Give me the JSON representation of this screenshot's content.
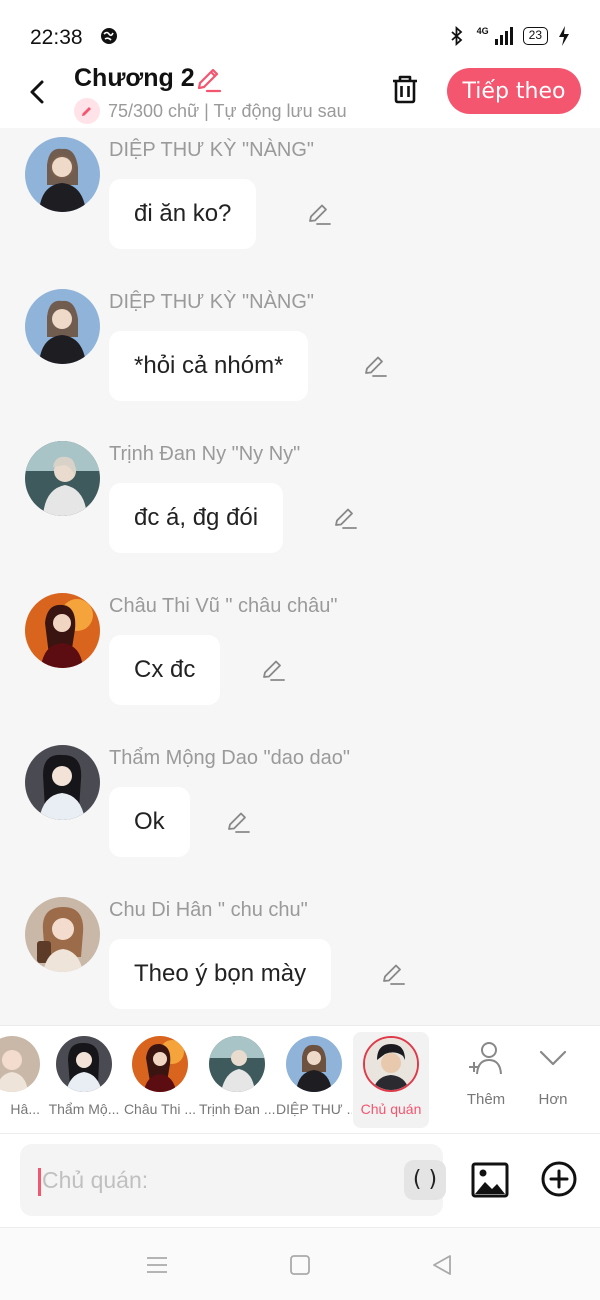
{
  "status_bar": {
    "time": "22:38",
    "network": "4G",
    "battery": "23"
  },
  "header": {
    "title": "Chương 2",
    "subtitle": "75/300 chữ | Tự động lưu sau",
    "next_label": "Tiếp theo"
  },
  "messages": [
    {
      "name": "DIỆP THƯ KỲ \"NÀNG\"",
      "text": "đi ăn ko?"
    },
    {
      "name": "DIỆP THƯ KỲ \"NÀNG\"",
      "text": "*hỏi cả nhóm*"
    },
    {
      "name": "Trịnh Đan Ny \"Ny Ny\"",
      "text": "đc á, đg đói"
    },
    {
      "name": "Châu Thi Vũ \" châu châu\"",
      "text": "Cx đc"
    },
    {
      "name": "Thẩm Mộng Dao \"dao dao\"",
      "text": "Ok"
    },
    {
      "name": "Chu Di Hân \" chu chu\"",
      "text": "Theo ý bọn mày"
    }
  ],
  "characters": [
    {
      "label": "Hâ..."
    },
    {
      "label": "Thẩm Mộ..."
    },
    {
      "label": "Châu Thi ..."
    },
    {
      "label": "Trịnh Đan ..."
    },
    {
      "label": "DIỆP THƯ ..."
    },
    {
      "label": "Chủ quán"
    }
  ],
  "tools": {
    "add_label": "Thêm",
    "more_label": "Hơn"
  },
  "input": {
    "placeholder": "Chủ quán:",
    "paren_label": "( )"
  },
  "colors": {
    "accent": "#f4556f",
    "background": "#f6f6f6"
  },
  "icons": [
    "back-arrow-icon",
    "pencil-icon",
    "trash-icon",
    "add-person-icon",
    "chevron-down-icon",
    "image-icon",
    "plus-circle-icon",
    "menu-icon",
    "home-square-icon",
    "back-triangle-icon"
  ]
}
